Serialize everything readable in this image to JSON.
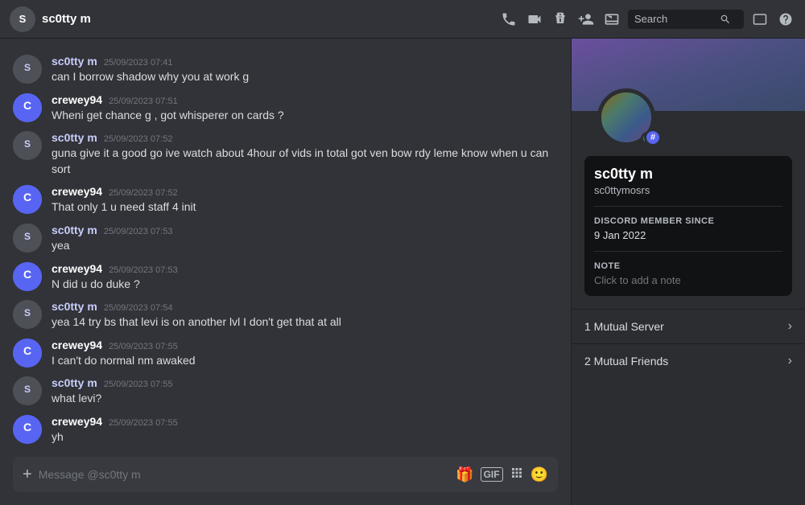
{
  "topbar": {
    "title": "sc0tty m",
    "search_placeholder": "Search",
    "icons": [
      "phone",
      "video",
      "pin",
      "add-friend",
      "dm-inbox"
    ]
  },
  "messages": [
    {
      "id": 1,
      "user": "sc0tty m",
      "userType": "sc0tty",
      "timestamp": "25/09/2023 07:41",
      "text": "can I borrow shadow why you at work g"
    },
    {
      "id": 2,
      "user": "crewey94",
      "userType": "crewey",
      "timestamp": "25/09/2023 07:51",
      "text": "Wheni get chance g , got whisperer on cards ?"
    },
    {
      "id": 3,
      "user": "sc0tty m",
      "userType": "sc0tty",
      "timestamp": "25/09/2023 07:52",
      "text": "guna give it a good go ive watch about 4hour of vids in total got ven bow rdy leme know when u can sort"
    },
    {
      "id": 4,
      "user": "crewey94",
      "userType": "crewey",
      "timestamp": "25/09/2023 07:52",
      "text": "That only 1 u need staff 4 init"
    },
    {
      "id": 5,
      "user": "sc0tty m",
      "userType": "sc0tty",
      "timestamp": "25/09/2023 07:53",
      "text": "yea"
    },
    {
      "id": 6,
      "user": "crewey94",
      "userType": "crewey",
      "timestamp": "25/09/2023 07:53",
      "text": "N did u do duke ?"
    },
    {
      "id": 7,
      "user": "sc0tty m",
      "userType": "sc0tty",
      "timestamp": "25/09/2023 07:54",
      "text": "yea 14 try bs that levi is on another lvl I don't get that at all"
    },
    {
      "id": 8,
      "user": "crewey94",
      "userType": "crewey",
      "timestamp": "25/09/2023 07:55",
      "text": "I can't do normal nm awaked"
    },
    {
      "id": 9,
      "user": "sc0tty m",
      "userType": "sc0tty",
      "timestamp": "25/09/2023 07:55",
      "text": "what levi?"
    },
    {
      "id": 10,
      "user": "crewey94",
      "userType": "crewey",
      "timestamp": "25/09/2023 07:55",
      "text": "yh"
    }
  ],
  "chat_input": {
    "placeholder": "Message @sc0tty m"
  },
  "profile": {
    "display_name": "sc0tty m",
    "username": "sc0ttymosrs",
    "discord_member_since_label": "DISCORD MEMBER SINCE",
    "discord_member_since": "9 Jan 2022",
    "note_label": "NOTE",
    "note_placeholder": "Click to add a note",
    "mutual_server_label": "1 Mutual Server",
    "mutual_friends_label": "2 Mutual Friends",
    "hashtag": "#"
  }
}
